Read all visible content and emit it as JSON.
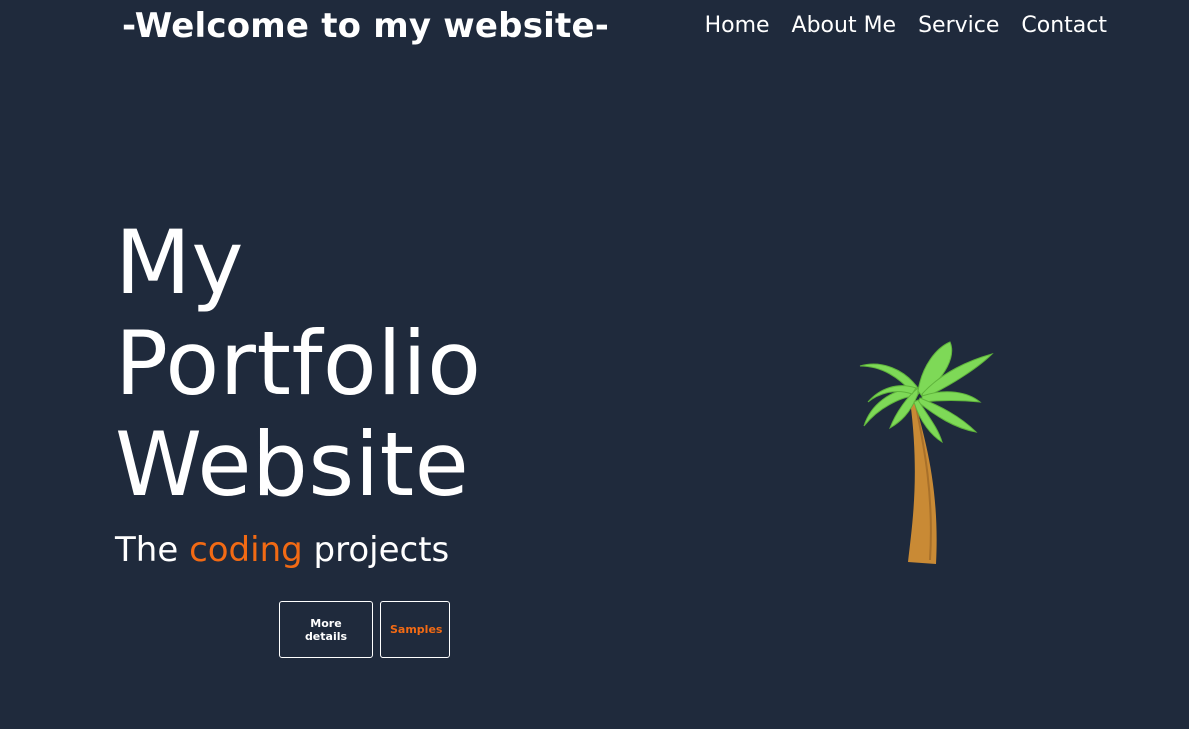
{
  "header": {
    "site_title": "-Welcome to my website-"
  },
  "nav": {
    "items": [
      "Home",
      "About Me",
      "Service",
      "Contact"
    ]
  },
  "hero": {
    "title_lines": [
      "My",
      "Portfolio",
      "Website"
    ],
    "subtitle_prefix": "The",
    "subtitle_accent": "coding",
    "subtitle_suffix": "projects",
    "buttons": {
      "details_label": "More details",
      "samples_label": "Samples"
    },
    "illustration_icon": "palm-tree-icon"
  },
  "colors": {
    "background": "#1f2a3c",
    "text": "#ffffff",
    "accent": "#f26a14",
    "palm_leaves": "#7ed957",
    "palm_trunk": "#c98a35"
  }
}
